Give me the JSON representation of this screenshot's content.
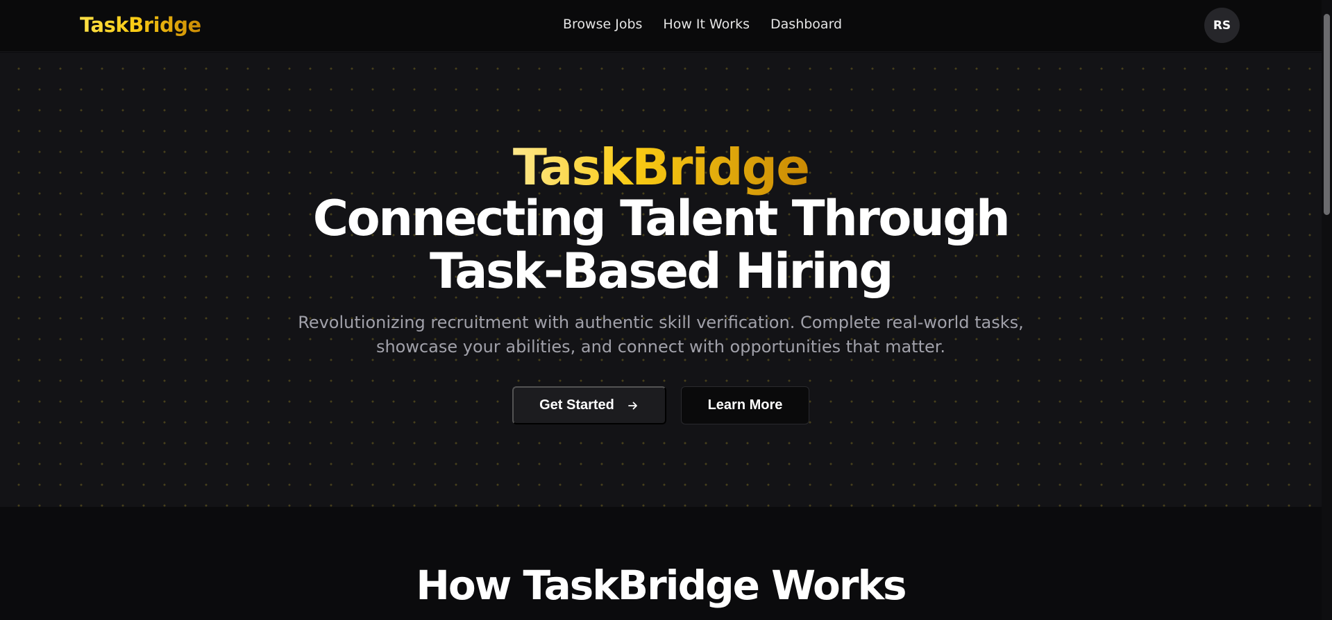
{
  "header": {
    "brand": "TaskBridge",
    "nav": [
      {
        "label": "Browse Jobs"
      },
      {
        "label": "How It Works"
      },
      {
        "label": "Dashboard"
      }
    ],
    "avatar_initials": "RS"
  },
  "hero": {
    "brand": "TaskBridge",
    "title_line1": "Connecting Talent Through",
    "title_line2": "Task-Based Hiring",
    "subtitle_line1": "Revolutionizing recruitment with authentic skill verification. Complete real-world tasks,",
    "subtitle_line2": "showcase your abilities, and connect with opportunities that matter.",
    "primary_cta": "Get Started",
    "secondary_cta": "Learn More"
  },
  "section2": {
    "title": "How TaskBridge Works"
  },
  "colors": {
    "accent_gold": "#facc15",
    "background": "#0b0b0d",
    "hero_background": "#131316"
  },
  "icons": {
    "cta_arrow": "arrow-right-icon"
  }
}
